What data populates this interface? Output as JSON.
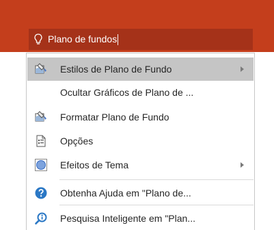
{
  "search": {
    "icon": "lightbulb-icon",
    "value": "Plano de fundos"
  },
  "menu": {
    "items": [
      {
        "label": "Estilos de Plano de Fundo",
        "icon": "background-styles-icon",
        "submenu": true
      },
      {
        "label": "Ocultar Gráficos de Plano de ...",
        "icon": "",
        "submenu": false
      },
      {
        "label": "Formatar Plano de Fundo",
        "icon": "format-background-icon",
        "submenu": false
      },
      {
        "label": "Opções",
        "icon": "options-page-icon",
        "submenu": false
      },
      {
        "label": "Efeitos de Tema",
        "icon": "theme-effects-icon",
        "submenu": true
      },
      {
        "label": "Obtenha Ajuda em \"Plano de...",
        "icon": "help-icon",
        "submenu": false
      },
      {
        "label": "Pesquisa Inteligente em \"Plan...",
        "icon": "smart-lookup-icon",
        "submenu": false
      }
    ]
  },
  "colors": {
    "ribbon": "#c43e1c",
    "search_box": "#a53219",
    "highlight": "#c5c5c5",
    "help_blue": "#2b78c5"
  }
}
